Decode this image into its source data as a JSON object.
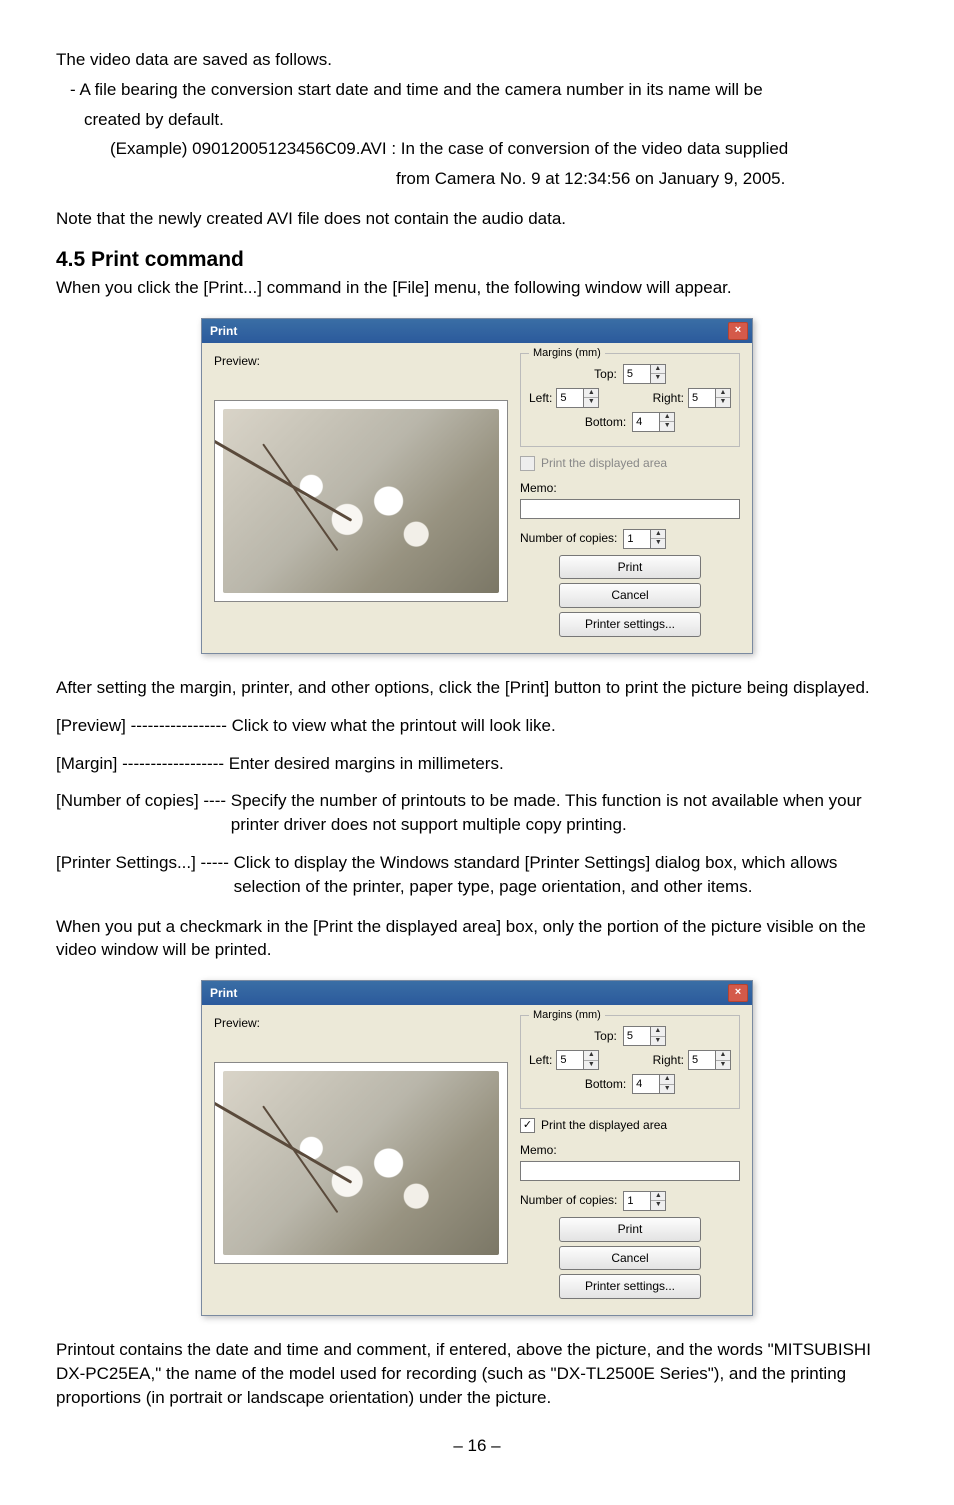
{
  "intro": {
    "l1": "The video data are saved as follows.",
    "l2": "- A file bearing the conversion start date and time and the camera number in its name will be",
    "l3": "created by default.",
    "l4": "(Example) 09012005123456C09.AVI : In the case of conversion of the video data supplied",
    "l5": "from Camera No. 9 at 12:34:56 on January 9, 2005.",
    "l6": "Note that the newly created AVI file does not contain the audio data."
  },
  "section_title": "4.5 Print command",
  "section_lead": "When you click the [Print...] command in the [File] menu, the following window will appear.",
  "dialog": {
    "title": "Print",
    "preview_label": "Preview:",
    "margins_legend": "Margins (mm)",
    "top_label": "Top:",
    "left_label": "Left:",
    "right_label": "Right:",
    "bottom_label": "Bottom:",
    "top_val": "5",
    "left_val": "5",
    "right_val": "5",
    "bottom_val": "4",
    "print_area_label": "Print the displayed area",
    "memo_label": "Memo:",
    "copies_label": "Number of copies:",
    "copies_val": "1",
    "print_btn": "Print",
    "cancel_btn": "Cancel",
    "settings_btn": "Printer settings..."
  },
  "after_dialog": "After setting the margin, printer, and other options, click the [Print] button to print the picture being displayed.",
  "defs": {
    "preview": {
      "label": "[Preview] ----------------- ",
      "body": "Click to view what the printout will look like."
    },
    "margin": {
      "label": "[Margin] ------------------ ",
      "body": "Enter desired margins in millimeters."
    },
    "copies": {
      "label": "[Number of copies] ---- ",
      "body": "Specify the number of printouts to be made. This function is not available when your printer driver does not support multiple copy printing."
    },
    "psettings": {
      "label": "[Printer Settings...] ----- ",
      "body": "Click to display the Windows standard [Printer Settings] dialog box, which allows selection of the printer, paper type, page orientation, and other items."
    }
  },
  "chk_para": "When you put a checkmark in the [Print the displayed area] box, only the portion of the picture visible on the video window will be printed.",
  "outro": "Printout contains the date and time and comment, if entered, above the picture, and the words \"MITSUBISHI DX-PC25EA,\" the name of the model used for recording (such as \"DX-TL2500E Series\"), and the printing proportions (in portrait or landscape orientation) under the picture.",
  "page_num": "– 16 –"
}
